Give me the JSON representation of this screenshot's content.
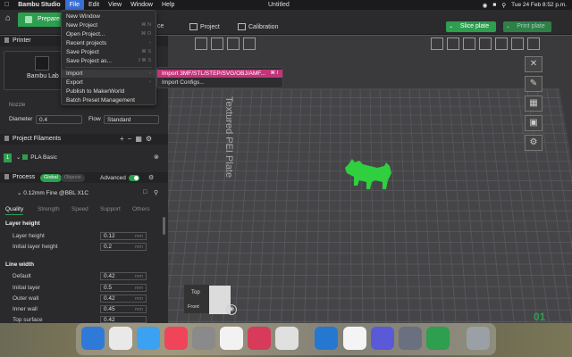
{
  "menubar": {
    "app": "Bambu Studio",
    "items": [
      "File",
      "Edit",
      "View",
      "Window",
      "Help"
    ],
    "window_title": "Untitled",
    "clock": "Tue 24 Feb 8:52 p.m."
  },
  "toolbar": {
    "tab_prepare": "Prepare",
    "tab_preview_tail": "ce",
    "tab_project": "Project",
    "tab_calibration": "Calibration",
    "slice_label": "Slice plate",
    "print_label": "Print plate"
  },
  "file_menu": {
    "items": [
      {
        "label": "New Window",
        "shortcut": ""
      },
      {
        "label": "New Project",
        "shortcut": "⌘ N"
      },
      {
        "label": "Open Project...",
        "shortcut": "⌘ O"
      },
      {
        "label": "Recent projects",
        "shortcut": "›"
      },
      {
        "label": "Save Project",
        "shortcut": "⌘ S"
      },
      {
        "label": "Save Project as...",
        "shortcut": "⇧⌘ S"
      },
      {
        "label": "Import",
        "shortcut": "›"
      },
      {
        "label": "Export",
        "shortcut": "›"
      },
      {
        "label": "Publish to MakerWorld",
        "shortcut": ""
      },
      {
        "label": "Batch Preset Management",
        "shortcut": ""
      }
    ]
  },
  "import_submenu": {
    "items": [
      {
        "label": "Import 3MF/STL/STEP/SVG/OBJ/AMF...",
        "shortcut": "⌘ I"
      },
      {
        "label": "Import Configs...",
        "shortcut": ""
      }
    ]
  },
  "sidebar": {
    "printer_header": "Printer",
    "printer_name": "Bambu Lab",
    "nozzle_label": "Nozzle",
    "diameter_label": "Diameter",
    "diameter_value": "0.4",
    "flow_label": "Flow",
    "flow_value": "Standard",
    "filaments_header": "Project Filaments",
    "filament_num": "1",
    "filament_name": "PLA Basic",
    "filament_color": "#2e9e4f",
    "process_header": "Process",
    "process_global": "Global",
    "process_objects": "Objects",
    "advanced_label": "Advanced",
    "process_preset": "0.12mm Fine @BBL X1C",
    "quality_tabs": [
      "Quality",
      "Strength",
      "Speed",
      "Support",
      "Others"
    ],
    "layer_height_group": "Layer height",
    "layer_height_label": "Layer height",
    "layer_height_value": "0.12",
    "initial_layer_height_label": "Initial layer height",
    "initial_layer_height_value": "0.2",
    "line_width_group": "Line width",
    "lw_default_label": "Default",
    "lw_default_value": "0.42",
    "lw_initial_label": "Initial layer",
    "lw_initial_value": "0.5",
    "lw_outer_label": "Outer wall",
    "lw_outer_value": "0.42",
    "lw_inner_label": "Inner wall",
    "lw_inner_value": "0.45",
    "lw_top_label": "Top surface",
    "lw_top_value": "0.42",
    "unit": "mm"
  },
  "canvas": {
    "plate_label": "Textured PEI Plate",
    "view_top": "Top",
    "view_front": "Front",
    "plate_number": "01",
    "model_color": "#2fcf3f"
  },
  "colors": {
    "accent": "#2e9e4f",
    "submenu_highlight": "#c2357a",
    "menubar_active": "#3a6fd8"
  }
}
